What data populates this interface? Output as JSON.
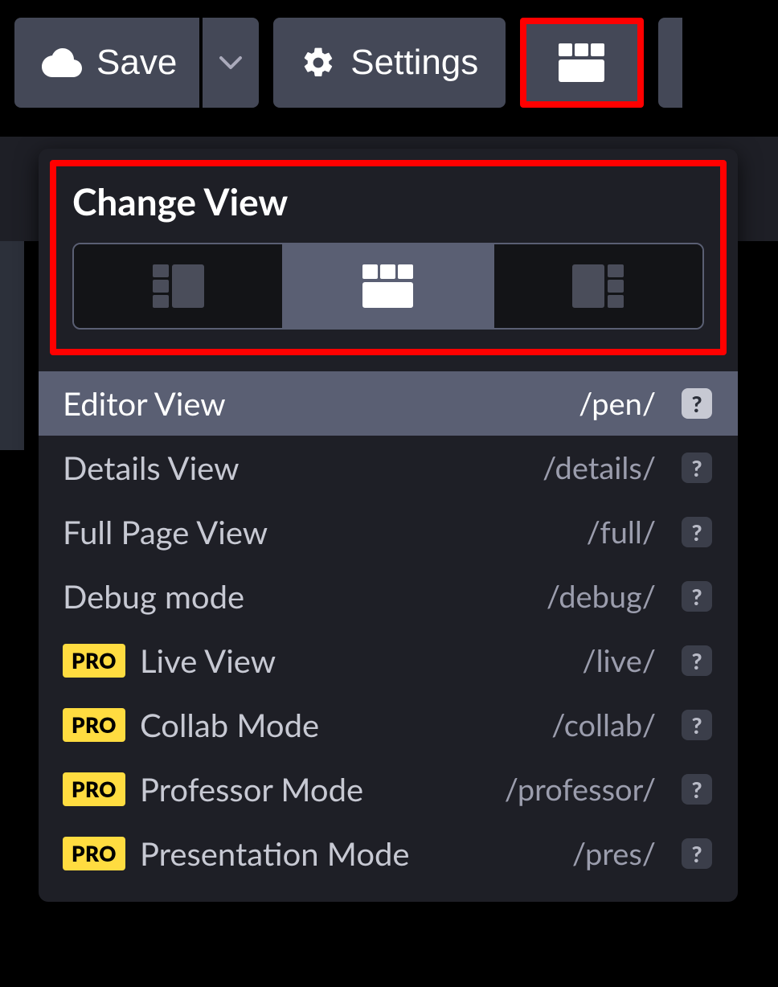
{
  "toolbar": {
    "save_label": "Save",
    "settings_label": "Settings"
  },
  "dropdown": {
    "title": "Change View",
    "layout_icons": [
      "left",
      "top",
      "right"
    ],
    "active_layout": 1,
    "items": [
      {
        "label": "Editor View",
        "path": "/pen/",
        "pro": false,
        "active": true
      },
      {
        "label": "Details View",
        "path": "/details/",
        "pro": false,
        "active": false
      },
      {
        "label": "Full Page View",
        "path": "/full/",
        "pro": false,
        "active": false
      },
      {
        "label": "Debug mode",
        "path": "/debug/",
        "pro": false,
        "active": false
      },
      {
        "label": "Live View",
        "path": "/live/",
        "pro": true,
        "active": false
      },
      {
        "label": "Collab Mode",
        "path": "/collab/",
        "pro": true,
        "active": false
      },
      {
        "label": "Professor Mode",
        "path": "/professor/",
        "pro": true,
        "active": false
      },
      {
        "label": "Presentation Mode",
        "path": "/pres/",
        "pro": true,
        "active": false
      }
    ],
    "pro_badge": "PRO",
    "help_glyph": "?"
  }
}
